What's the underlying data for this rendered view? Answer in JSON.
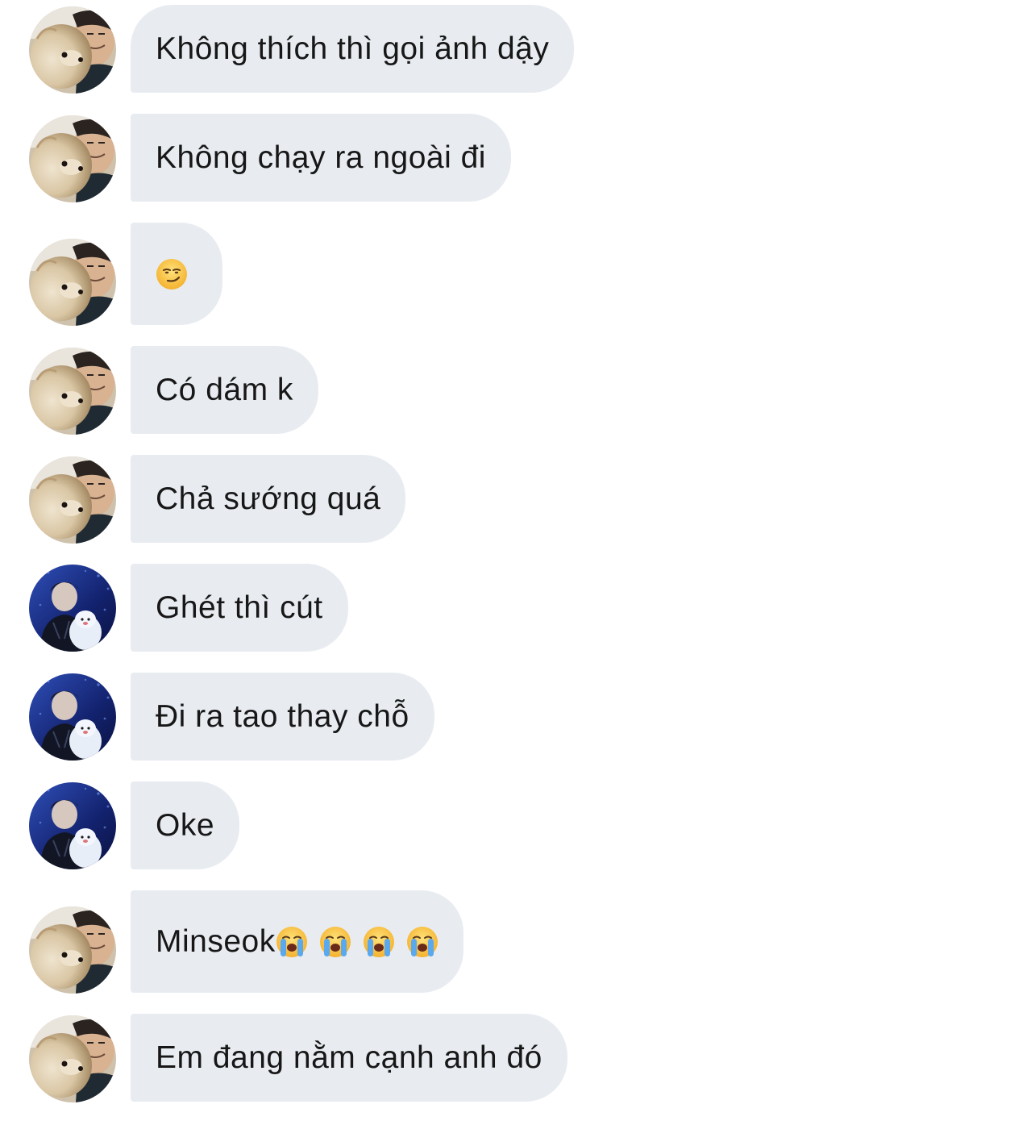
{
  "colors": {
    "bubble_bg": "#e8ecf1",
    "text": "#171717",
    "page_bg": "#ffffff"
  },
  "messages": [
    {
      "sender": "avatar-dog-boy",
      "text": "Không thích thì gọi ảnh dậy"
    },
    {
      "sender": "avatar-dog-boy",
      "text": "Không chạy ra ngoài đi"
    },
    {
      "sender": "avatar-dog-boy",
      "text": "",
      "emoji": "smirking-face-emoji"
    },
    {
      "sender": "avatar-dog-boy",
      "text": "Có dám k"
    },
    {
      "sender": "avatar-dog-boy",
      "text": "Chả sướng quá"
    },
    {
      "sender": "avatar-blue-concert",
      "text": "Ghét thì cút"
    },
    {
      "sender": "avatar-blue-concert",
      "text": "Đi ra tao thay chỗ"
    },
    {
      "sender": "avatar-blue-concert",
      "text": "Oke"
    },
    {
      "sender": "avatar-dog-boy",
      "text": "Minseok",
      "emoji": "loudly-crying-face-emoji",
      "emoji_count": 4
    },
    {
      "sender": "avatar-dog-boy",
      "text": "Em đang nằm cạnh anh đó"
    }
  ]
}
